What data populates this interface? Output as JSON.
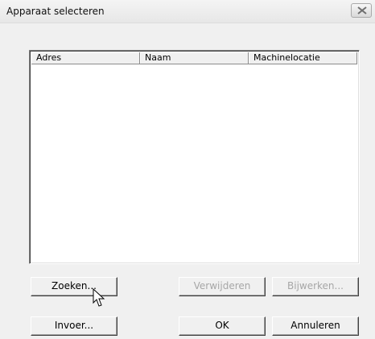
{
  "window": {
    "title": "Apparaat selecteren"
  },
  "list": {
    "columns": [
      "Adres",
      "Naam",
      "Machinelocatie"
    ],
    "rows": []
  },
  "buttons": {
    "search": "Zoeken...",
    "remove": "Verwijderen",
    "update": "Bijwerken...",
    "input": "Invoer...",
    "ok": "OK",
    "cancel": "Annuleren"
  },
  "states": {
    "remove_enabled": false,
    "update_enabled": false
  }
}
